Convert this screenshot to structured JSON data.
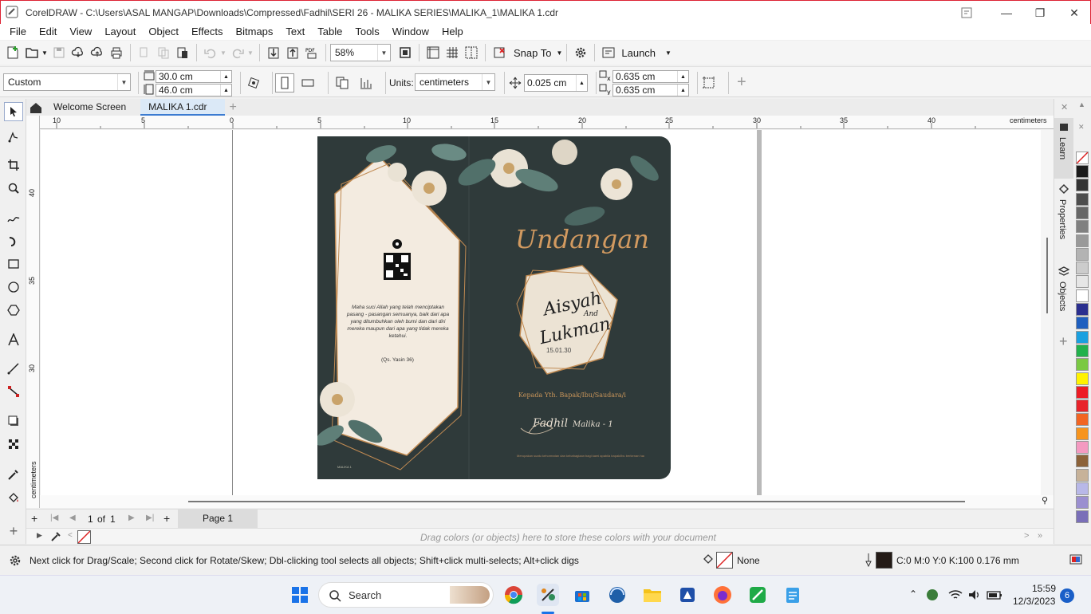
{
  "window": {
    "title": "CorelDRAW - C:\\Users\\ASAL MANGAP\\Downloads\\Compressed\\Fadhil\\SERI 26 - MALIKA SERIES\\MALIKA_1\\MALIKA 1.cdr"
  },
  "menu": [
    "File",
    "Edit",
    "View",
    "Layout",
    "Object",
    "Effects",
    "Bitmaps",
    "Text",
    "Table",
    "Tools",
    "Window",
    "Help"
  ],
  "std_toolbar": {
    "zoom": "58%",
    "snap_to": "Snap To",
    "launch": "Launch"
  },
  "prop_bar": {
    "page_preset": "Custom",
    "width": "30.0 cm",
    "height": "46.0 cm",
    "units_label": "Units:",
    "units": "centimeters",
    "nudge": "0.025 cm",
    "dup_x": "0.635 cm",
    "dup_y": "0.635 cm"
  },
  "tabs": [
    "Welcome Screen",
    "MALIKA 1.cdr"
  ],
  "ruler": {
    "h_labels": [
      "10",
      "5",
      "0",
      "5",
      "10",
      "15",
      "20",
      "25",
      "30",
      "35",
      "40"
    ],
    "h_unit": "centimeters",
    "v_labels": [
      "40",
      "35",
      "30"
    ],
    "v_unit": "centimeters"
  },
  "design": {
    "title_script": "Undangan",
    "names_line1": "Aisyah",
    "names_and": "And",
    "names_line2": "Lukman",
    "date": "15.01.30",
    "recipient": "Kepada Yth. Bapak/Ibu/Saudara/i",
    "signature": "Fadhil",
    "series": "Malika - 1",
    "footer_small": "Merupakan suatu kehormatan dan kebahagiaan bagi kami apabila bapak/ibu berkenan hadir",
    "verse": "Maha suci Allah yang telah menciptakan pasang - pasangan semuanya, baik dari apa yang ditumbuhkan oleh bumi dan dari diri mereka maupun dari apa yang tidak mereka ketahui.",
    "verse_ref": "(Qs. Yasin 36)",
    "back_mark": "MALIKA 1"
  },
  "docker_tabs": [
    "Learn",
    "Properties",
    "Objects"
  ],
  "page_nav": {
    "current": "1",
    "of_label": "of",
    "total": "1",
    "page_tab": "Page 1"
  },
  "colorbar_hint": "Drag colors (or objects) here to store these colors with your document",
  "status": {
    "hint": "Next click for Drag/Scale; Second click for Rotate/Skew; Dbl-clicking tool selects all objects; Shift+click multi-selects; Alt+click digs",
    "fill": "None",
    "outline": "C:0 M:0 Y:0 K:100  0.176 mm"
  },
  "taskbar": {
    "search": "Search",
    "time": "15:59",
    "date": "12/3/2023",
    "notifications": "6"
  },
  "palette_colors": [
    "#1a1a1a",
    "#333333",
    "#4d4d4d",
    "#666666",
    "#808080",
    "#999999",
    "#b3b3b3",
    "#cccccc",
    "#e6e6e6",
    "#ffffff",
    "#2b2f8f",
    "#1f5fbf",
    "#1aa0e0",
    "#22b14c",
    "#7ac943",
    "#fff200",
    "#ed1c24",
    "#e8232a",
    "#f26522",
    "#f7941d",
    "#f49ac1",
    "#8c6239",
    "#c7b299",
    "#b8b8e8",
    "#9b8fd0",
    "#7a6fb8"
  ],
  "accent": "#2f3a3a"
}
